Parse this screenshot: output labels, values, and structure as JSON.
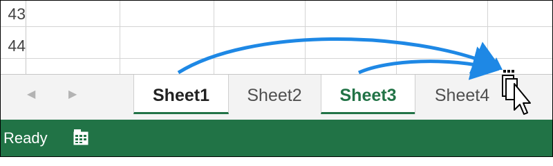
{
  "grid": {
    "rows": [
      {
        "number_fragment": "43"
      },
      {
        "number_fragment": "44"
      }
    ]
  },
  "tabs": [
    {
      "label": "Sheet1",
      "selected": true
    },
    {
      "label": "Sheet2",
      "selected": false
    },
    {
      "label": "Sheet3",
      "selected": true
    },
    {
      "label": "Sheet4",
      "selected": false
    }
  ],
  "nav": {
    "prev_icon": "triangle-left-icon",
    "next_icon": "triangle-right-icon"
  },
  "status": {
    "text": "Ready",
    "macro_icon": "macro-record-icon"
  },
  "colors": {
    "accent_green": "#217346",
    "arrow_blue": "#1e88e5"
  },
  "cursor_icon": "copy-sheet-cursor-icon"
}
